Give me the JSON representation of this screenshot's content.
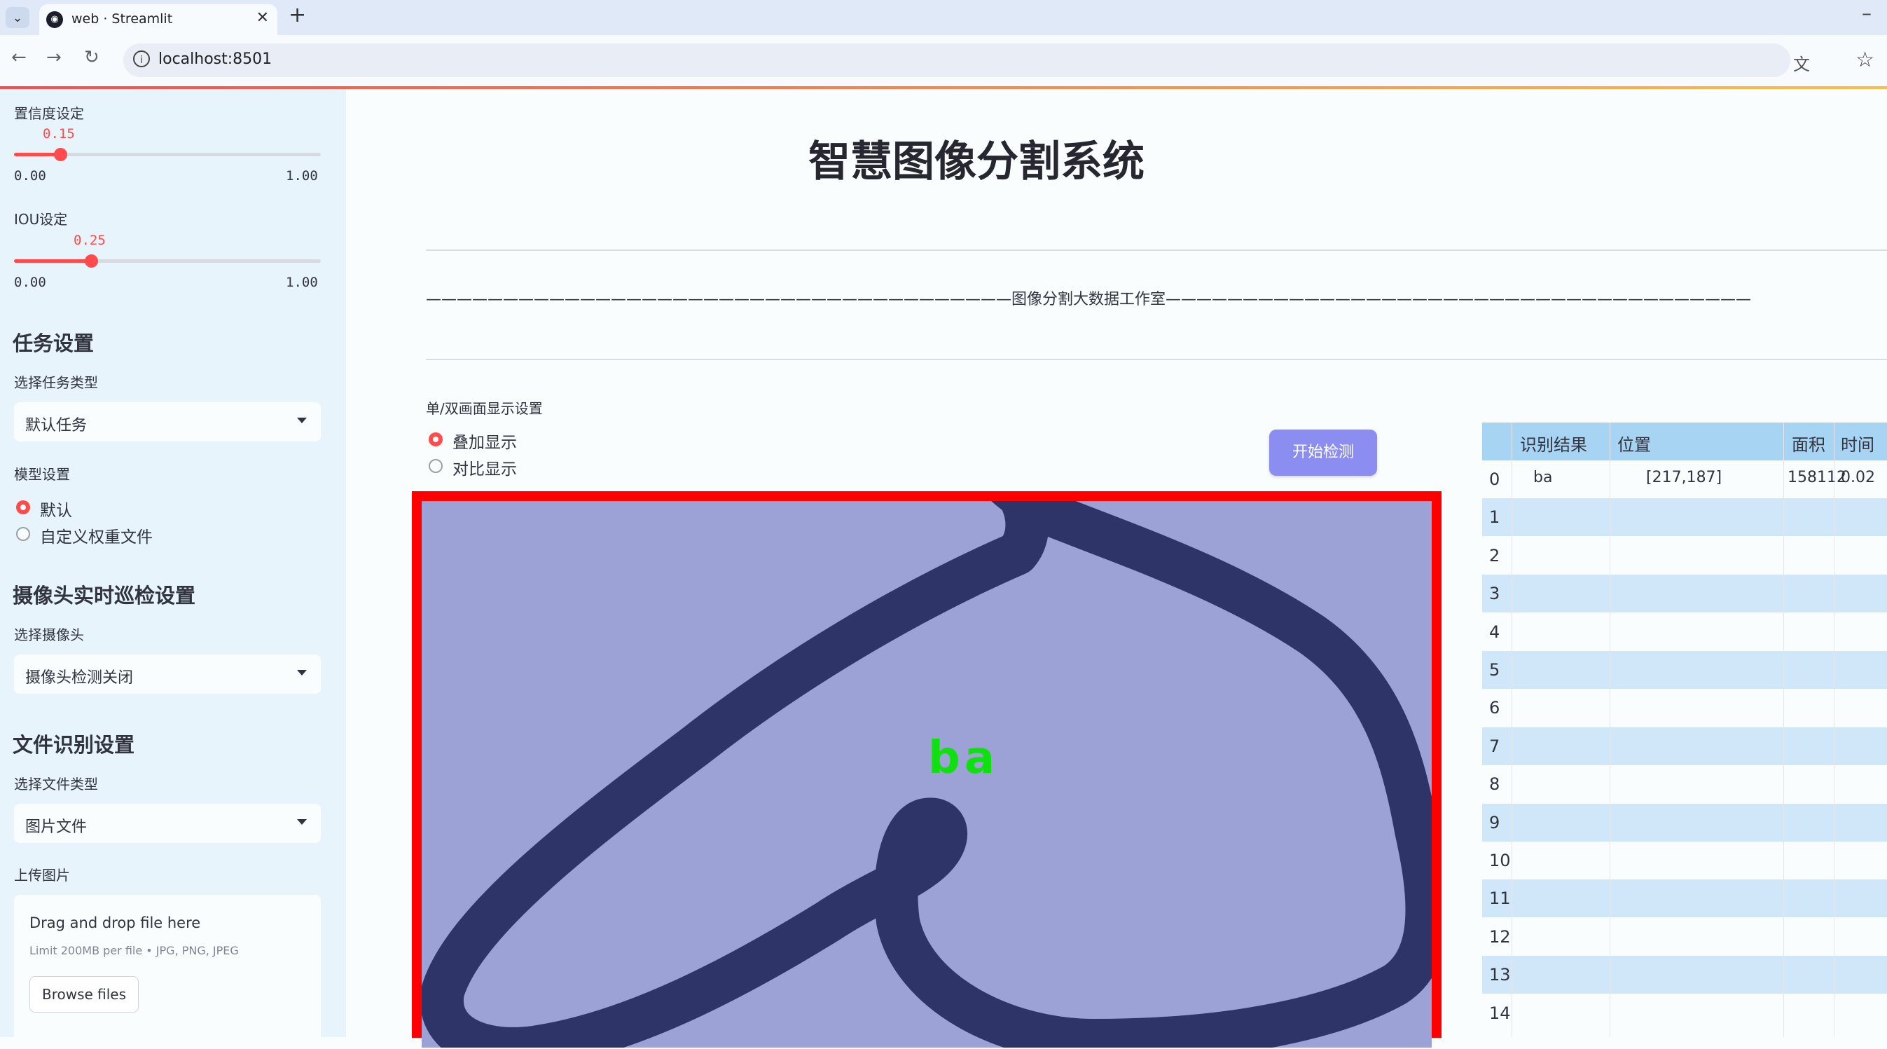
{
  "browser": {
    "tab_title": "web · Streamlit",
    "url": "localhost:8501"
  },
  "sidebar": {
    "confidence": {
      "label": "置信度设定",
      "value": "0.15",
      "min": "0.00",
      "max": "1.00",
      "fraction": 0.15
    },
    "iou": {
      "label": "IOU设定",
      "value": "0.25",
      "min": "0.00",
      "max": "1.00",
      "fraction": 0.25
    },
    "task_section": "任务设置",
    "task_type_label": "选择任务类型",
    "task_type_value": "默认任务",
    "model_label": "模型设置",
    "model_options": [
      "默认",
      "自定义权重文件"
    ],
    "model_selected": "默认",
    "camera_section": "摄像头实时巡检设置",
    "camera_label": "选择摄像头",
    "camera_value": "摄像头检测关闭",
    "file_section": "文件识别设置",
    "file_type_label": "选择文件类型",
    "file_type_value": "图片文件",
    "upload_label": "上传图片",
    "upload": {
      "title": "Drag and drop file here",
      "limit": "Limit 200MB per file • JPG, PNG, JPEG",
      "button": "Browse files"
    }
  },
  "main": {
    "title": "智慧图像分割系统",
    "studio_line": "——————————————————————————————————————图像分割大数据工作室——————————————————————————————————————",
    "display_mode_label": "单/双画面显示设置",
    "display_options": [
      "叠加显示",
      "对比显示"
    ],
    "display_selected": "叠加显示",
    "start_button": "开始检测",
    "detection_label": "ba"
  },
  "results": {
    "columns": [
      "识别结果",
      "位置",
      "面积",
      "时间"
    ],
    "rows": [
      {
        "index": "0",
        "result": "ba",
        "position": "[217,187]",
        "area": "158112",
        "time": "0.02"
      },
      {
        "index": "1"
      },
      {
        "index": "2"
      },
      {
        "index": "3"
      },
      {
        "index": "4"
      },
      {
        "index": "5"
      },
      {
        "index": "6"
      },
      {
        "index": "7"
      },
      {
        "index": "8"
      },
      {
        "index": "9"
      },
      {
        "index": "10"
      },
      {
        "index": "11"
      },
      {
        "index": "12"
      },
      {
        "index": "13"
      },
      {
        "index": "14"
      }
    ]
  },
  "colors": {
    "accent": "#ff4b4b",
    "sidebar_bg": "#e7f4fb",
    "start_button": "#8b8ef0",
    "detection_frame": "#ff0000",
    "mask_fill": "#9ca1d6",
    "stroke": "#2f3468",
    "label_green": "#10e010"
  }
}
